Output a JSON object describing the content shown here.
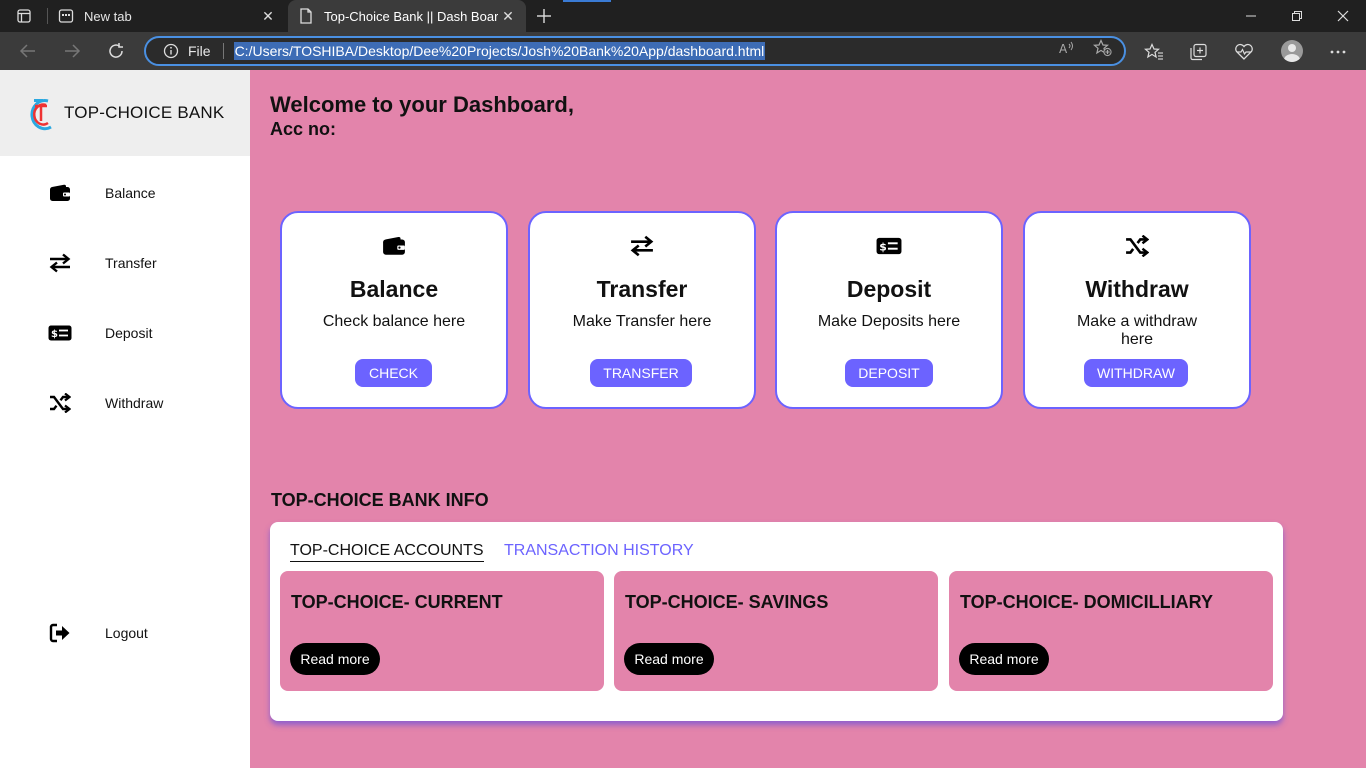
{
  "browser": {
    "tabs": [
      {
        "label": "New tab"
      },
      {
        "label": "Top-Choice Bank || Dash Board"
      }
    ],
    "address": {
      "scheme_label": "File",
      "url": "C:/Users/TOSHIBA/Desktop/Dee%20Projects/Josh%20Bank%20App/dashboard.html"
    }
  },
  "sidebar": {
    "brand": "TOP-CHOICE BANK",
    "items": [
      {
        "label": "Balance",
        "icon": "wallet-icon"
      },
      {
        "label": "Transfer",
        "icon": "transfer-arrows-icon"
      },
      {
        "label": "Deposit",
        "icon": "money-bill-icon"
      },
      {
        "label": "Withdraw",
        "icon": "shuffle-icon"
      }
    ],
    "logout": {
      "label": "Logout",
      "icon": "logout-icon"
    }
  },
  "header": {
    "welcome": "Welcome to your Dashboard,",
    "acc_no": "Acc no:"
  },
  "cards": [
    {
      "title": "Balance",
      "desc": "Check balance here",
      "button": "CHECK",
      "icon": "wallet-icon"
    },
    {
      "title": "Transfer",
      "desc": "Make Transfer here",
      "button": "TRANSFER",
      "icon": "transfer-arrows-icon"
    },
    {
      "title": "Deposit",
      "desc": "Make Deposits here",
      "button": "DEPOSIT",
      "icon": "money-bill-icon"
    },
    {
      "title": "Withdraw",
      "desc": "Make a withdraw here",
      "button": "WITHDRAW",
      "icon": "shuffle-icon"
    }
  ],
  "info": {
    "title": "TOP-CHOICE BANK INFO",
    "tabs": [
      "TOP-CHOICE ACCOUNTS",
      "TRANSACTION HISTORY"
    ],
    "accounts": [
      {
        "name": "TOP-CHOICE- CURRENT",
        "button": "Read more"
      },
      {
        "name": "TOP-CHOICE- SAVINGS",
        "button": "Read more"
      },
      {
        "name": "TOP-CHOICE- DOMICILLIARY",
        "button": "Read more"
      }
    ]
  },
  "colors": {
    "page_bg": "#e384ab",
    "accent": "#6c63ff",
    "sidebar_bg": "#ffffff",
    "brand_bg": "#eeeeee"
  }
}
